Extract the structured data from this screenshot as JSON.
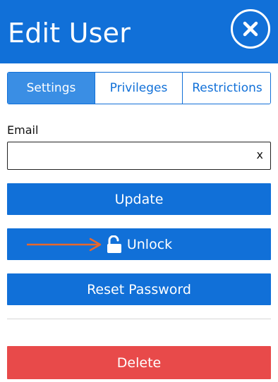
{
  "header": {
    "title": "Edit User",
    "close_icon": "close-icon"
  },
  "tabs": [
    {
      "label": "Settings",
      "active": true
    },
    {
      "label": "Privileges",
      "active": false
    },
    {
      "label": "Restrictions",
      "active": false
    }
  ],
  "email": {
    "label": "Email",
    "value": "",
    "placeholder": "",
    "clear": "x"
  },
  "buttons": {
    "update": "Update",
    "unlock": "Unlock",
    "unlock_icon": "unlock-icon",
    "reset_password": "Reset Password",
    "delete": "Delete"
  },
  "annotation": {
    "arrow_color": "#e8672a"
  },
  "colors": {
    "primary": "#1170d8",
    "tab_active": "#3a8ee4",
    "danger": "#e84a4a"
  }
}
